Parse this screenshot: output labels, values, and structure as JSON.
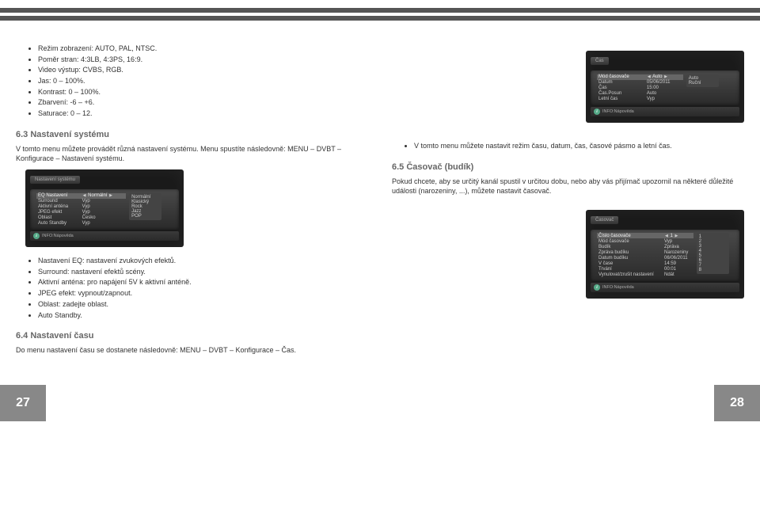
{
  "page_left": "27",
  "page_right": "28",
  "left_col": {
    "bullets1": [
      "Režim zobrazení: AUTO, PAL, NTSC.",
      "Poměr stran: 4:3LB, 4:3PS, 16:9.",
      "Video výstup: CVBS, RGB.",
      "Jas: 0 – 100%.",
      "Kontrast: 0 – 100%.",
      "Zbarvení: -6 – +6.",
      "Saturace: 0 – 12."
    ],
    "h63": "6.3  Nastavení systému",
    "p63": "V tomto menu můžete provádět různá nastavení systému. Menu spustíte následovně: MENU – DVBT – Konfigurace – Nastavení systému.",
    "shot1_title": "Nastavení systému",
    "shot1_rows": [
      [
        "EQ Nastavení",
        "Normální"
      ],
      [
        "Surround",
        "Vyp"
      ],
      [
        "Aktivní anténa",
        "Vyp"
      ],
      [
        "JPEG efekt",
        "Vyp"
      ],
      [
        "Oblast",
        "Česko"
      ],
      [
        "Auto Standby",
        "Vyp"
      ]
    ],
    "shot1_side": [
      "Normální",
      "Klasický",
      "Rock",
      "Jazz",
      "POP"
    ],
    "shot1_info": "INFO:Nápověda",
    "bullets2": [
      "Nastavení EQ: nastavení zvukových efektů.",
      "Surround: nastavení efektů scény.",
      "Aktivní anténa: pro napájení 5V k aktivní anténě.",
      "JPEG efekt: vypnout/zapnout.",
      "Oblast: zadejte oblast.",
      "Auto Standby."
    ],
    "h64": "6.4  Nastavení času",
    "p64": "Do menu nastavení času se dostanete následovně: MENU – DVBT – Konfigurace – Čas."
  },
  "right_col": {
    "shot2_title": "Čas",
    "shot2_rows": [
      [
        "Mód časovače",
        "Auto"
      ],
      [
        "Datum",
        "05/06/2011"
      ],
      [
        "Čas",
        "15:00"
      ],
      [
        "Čas.Posun",
        "Auto"
      ],
      [
        "Letní čas",
        "Vyp"
      ]
    ],
    "shot2_side": [
      "Auto",
      "Ruční"
    ],
    "shot2_info": "INFO:Nápověda",
    "bullet_r1": "V tomto menu můžete nastavit režim času, datum, čas, časové pásmo a letní čas.",
    "h65": "6.5  Časovač (budík)",
    "p65": "Pokud chcete, aby se určitý kanál spustil v určitou dobu, nebo aby vás přijímač upozornil na některé důležité události (narozeniny, ...), můžete nastavit časovač.",
    "shot3_title": "Časovač",
    "shot3_rows": [
      [
        "Číslo časovače",
        "1"
      ],
      [
        "Mód časovače",
        "Vyp"
      ],
      [
        "Budík",
        "Zpráva"
      ],
      [
        "Zpráva budíku",
        "Narozeniny"
      ],
      [
        "Datum budíku",
        "06/06/2011"
      ],
      [
        "V čase",
        "14:59"
      ],
      [
        "Trvání",
        "00:01"
      ],
      [
        "Vynulovat/zrušit nastavení",
        "Ndát"
      ]
    ],
    "shot3_side": [
      "1",
      "2",
      "3",
      "4",
      "5",
      "6",
      "7",
      "8"
    ],
    "shot3_info": "INFO:Nápověda"
  }
}
